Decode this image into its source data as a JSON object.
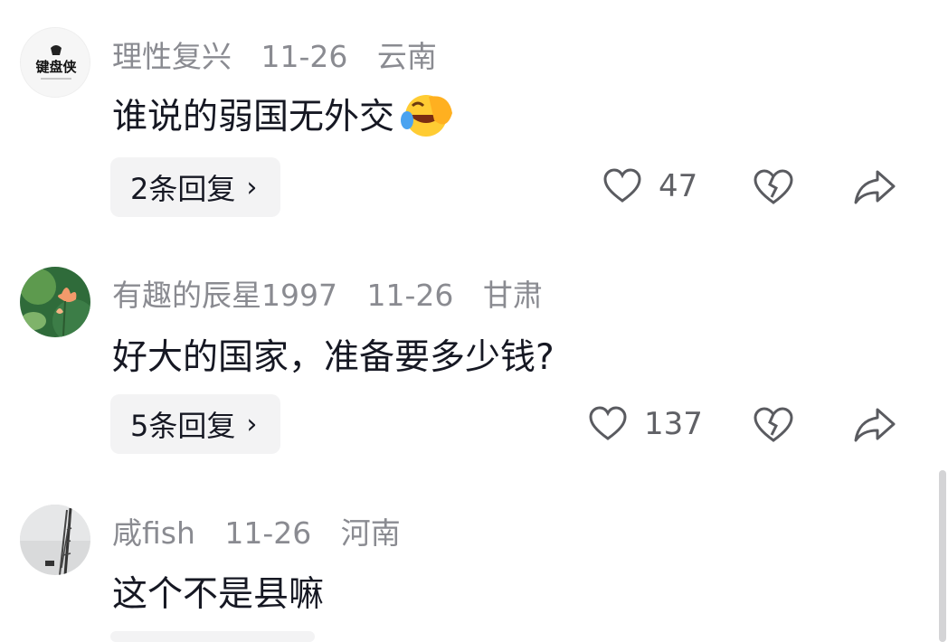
{
  "comments": [
    {
      "author": "理性复兴",
      "date": "11-26",
      "location": "云南",
      "text": "谁说的弱国无外交",
      "emoji": "🤣",
      "replies": "2条回复",
      "likes": "47",
      "avatar_text": "键盘侠"
    },
    {
      "author": "有趣的辰星1997",
      "date": "11-26",
      "location": "甘肃",
      "text": "好大的国家，准备要多少钱?",
      "replies": "5条回复",
      "likes": "137"
    },
    {
      "author": "咸fish",
      "date": "11-26",
      "location": "河南",
      "text": "这个不是县嘛"
    }
  ],
  "icons": {
    "chevron": "›",
    "like": "heart-outline-icon",
    "dislike": "broken-heart-icon",
    "share": "share-arrow-icon"
  }
}
